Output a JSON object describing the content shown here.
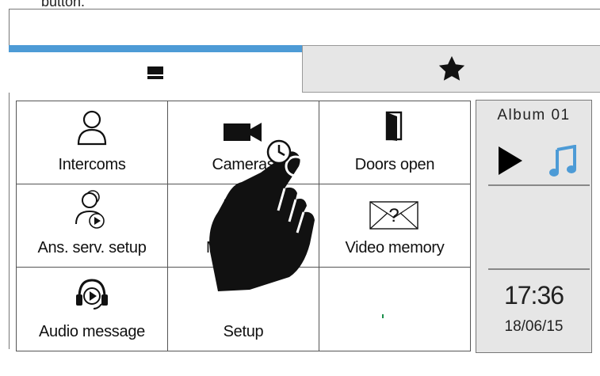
{
  "header": {
    "caption": "button."
  },
  "tabs": [
    {
      "id": "home",
      "icon": "home-glyph-icon",
      "active": true
    },
    {
      "id": "favorites",
      "icon": "star-icon",
      "active": false
    }
  ],
  "grid": {
    "cells": [
      {
        "label": "Intercoms",
        "icon": "person-icon"
      },
      {
        "label": "Cameras",
        "icon": "video-camera-icon"
      },
      {
        "label": "Doors open",
        "icon": "door-open-icon"
      },
      {
        "label": "Ans. serv. setup",
        "icon": "answering-service-icon"
      },
      {
        "label": "M",
        "icon": "memo-icon"
      },
      {
        "label": "Video memory",
        "icon": "video-memory-envelope-icon"
      },
      {
        "label": "Audio message",
        "icon": "headset-play-icon"
      },
      {
        "label": "Setup",
        "icon": "setup-icon"
      },
      {
        "label": "",
        "icon": ""
      }
    ]
  },
  "video_memory_glyph": "?",
  "media": {
    "album": "Album 01",
    "play_icon": "play-icon",
    "music_icon": "music-note-icon",
    "accent": "#4d9bd6"
  },
  "clock": {
    "time": "17:36",
    "date": "18/06/15"
  },
  "colors": {
    "tab_accent": "#4d9bd6",
    "panel_bg": "#e6e6e6",
    "inactive_tab_bg": "#e6e6e6"
  }
}
